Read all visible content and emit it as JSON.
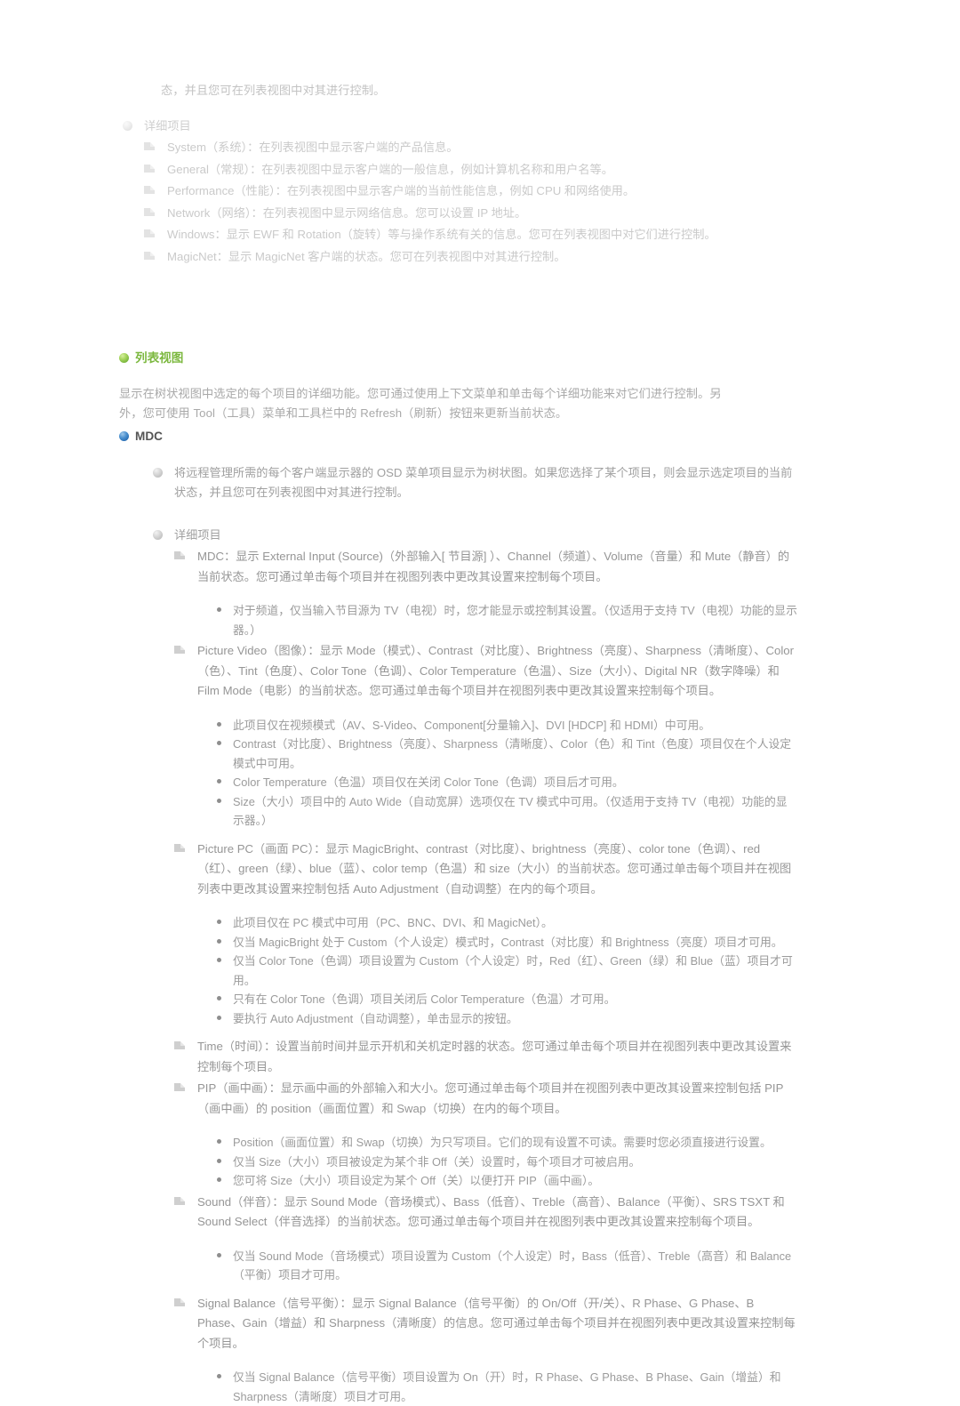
{
  "document": {
    "continuation_line": "态，并且您可在列表视图中对其进行控制。",
    "tree_view_section": {
      "detail_items_label": "详细项目",
      "items": [
        "System（系统）：在列表视图中显示客户端的产品信息。",
        "General（常规）：在列表视图中显示客户端的一般信息，例如计算机名称和用户名等。",
        "Performance（性能）：在列表视图中显示客户端的当前性能信息，例如 CPU 和网络使用。",
        "Network（网络）：在列表视图中显示网络信息。您可以设置 IP 地址。",
        "Windows：显示 EWF 和 Rotation（旋转）等与操作系统有关的信息。您可在列表视图中对它们进行控制。",
        "MagicNet：显示 MagicNet 客户端的状态。您可在列表视图中对其进行控制。"
      ]
    },
    "list_view_section": {
      "heading": "列表视图",
      "heading_bullet": "green-sphere-icon",
      "paragraph": "显示在树状视图中选定的每个项目的详细功能。您可通过使用上下文菜单和单击每个详细功能来对它们进行控制。另外，您可使用 Tool（工具）菜单和工具栏中的 Refresh（刷新）按钮来更新当前状态。"
    },
    "mdc_section": {
      "heading": "MDC",
      "heading_bullet": "blue-sphere-icon",
      "intro": "将远程管理所需的每个客户端显示器的 OSD 菜单项目显示为树状图。如果您选择了某个项目，则会显示选定项目的当前状态，并且您可在列表视图中对其进行控制。",
      "detail_items_label": "详细项目",
      "entries": [
        {
          "text": "MDC：显示 External Input (Source)（外部输入[ 节目源] ）、Channel（频道）、Volume（音量）和 Mute（静音）的当前状态。您可通过单击每个项目并在视图列表中更改其设置来控制每个项目。",
          "notes": [
            "对于频道，仅当输入节目源为 TV（电视）时，您才能显示或控制其设置。（仅适用于支持 TV（电视）功能的显示器。）"
          ]
        },
        {
          "text": "Picture Video（图像）：显示 Mode（模式）、Contrast（对比度）、Brightness（亮度）、Sharpness（清晰度）、Color（色）、Tint（色度）、Color Tone（色调）、Color Temperature（色温）、Size（大小）、Digital NR（数字降噪）和 Film Mode（电影）的当前状态。您可通过单击每个项目并在视图列表中更改其设置来控制每个项目。",
          "notes": [
            "此项目仅在视频模式（AV、S-Video、Component[分量输入]、DVI [HDCP] 和 HDMI）中可用。",
            "Contrast（对比度）、Brightness（亮度）、Sharpness（清晰度）、Color（色）和 Tint（色度）项目仅在个人设定模式中可用。",
            "Color Temperature（色温）项目仅在关闭 Color Tone（色调）项目后才可用。",
            "Size（大小）项目中的 Auto Wide（自动宽屏）选项仅在 TV 模式中可用。（仅适用于支持 TV（电视）功能的显示器。）"
          ]
        },
        {
          "text": "Picture PC（画面 PC）：显示 MagicBright、contrast（对比度）、brightness（亮度）、color tone（色调）、red（红）、green（绿）、blue（蓝）、color temp（色温）和 size（大小）的当前状态。您可通过单击每个项目并在视图列表中更改其设置来控制包括 Auto Adjustment（自动调整）在内的每个项目。",
          "notes": [
            "此项目仅在 PC 模式中可用（PC、BNC、DVI、和 MagicNet）。",
            "仅当 MagicBright 处于 Custom（个人设定）模式时，Contrast（对比度）和 Brightness（亮度）项目才可用。",
            "仅当 Color Tone（色调）项目设置为 Custom（个人设定）时，Red（红）、Green（绿）和 Blue（蓝）项目才可用。",
            "只有在 Color Tone（色调）项目关闭后 Color Temperature（色温）才可用。",
            "要执行 Auto Adjustment（自动调整），单击显示的按钮。"
          ]
        },
        {
          "text": "Time（时间）：设置当前时间并显示开机和关机定时器的状态。您可通过单击每个项目并在视图列表中更改其设置来控制每个项目。",
          "notes": []
        },
        {
          "text": "PIP（画中画）：显示画中画的外部输入和大小。您可通过单击每个项目并在视图列表中更改其设置来控制包括 PIP（画中画）的 position（画面位置）和 Swap（切换）在内的每个项目。",
          "notes": [
            "Position（画面位置）和 Swap（切换）为只写项目。它们的现有设置不可读。需要时您必须直接进行设置。",
            "仅当 Size（大小）项目被设定为某个非 Off（关）设置时，每个项目才可被启用。",
            "您可将 Size（大小）项目设定为某个 Off（关）以便打开 PIP（画中画）。"
          ]
        },
        {
          "text": "Sound（伴音）：显示 Sound Mode（音场模式）、Bass（低音）、Treble（高音）、Balance（平衡）、SRS TSXT 和 Sound Select（伴音选择）的当前状态。您可通过单击每个项目并在视图列表中更改其设置来控制每个项目。",
          "notes": [
            "仅当 Sound Mode（音场模式）项目设置为 Custom（个人设定）时，Bass（低音）、Treble（高音）和 Balance（平衡）项目才可用。"
          ]
        },
        {
          "text": "Signal Balance（信号平衡）：显示 Signal Balance（信号平衡）的 On/Off（开/关）、R Phase、G Phase、B Phase、Gain（增益）和 Sharpness（清晰度）的信息。您可通过单击每个项目并在视图列表中更改其设置来控制每个项目。",
          "notes": [
            "仅当 Signal Balance（信号平衡）项目设置为 On（开）时，R Phase、G Phase、B Phase、Gain（增益）和 Sharpness（清晰度）项目才可用。"
          ]
        }
      ]
    }
  },
  "colors": {
    "green_accent": "#7cb83f",
    "blue_accent": "#2a6fb5",
    "body_text": "#909090",
    "background": "#ffffff"
  }
}
